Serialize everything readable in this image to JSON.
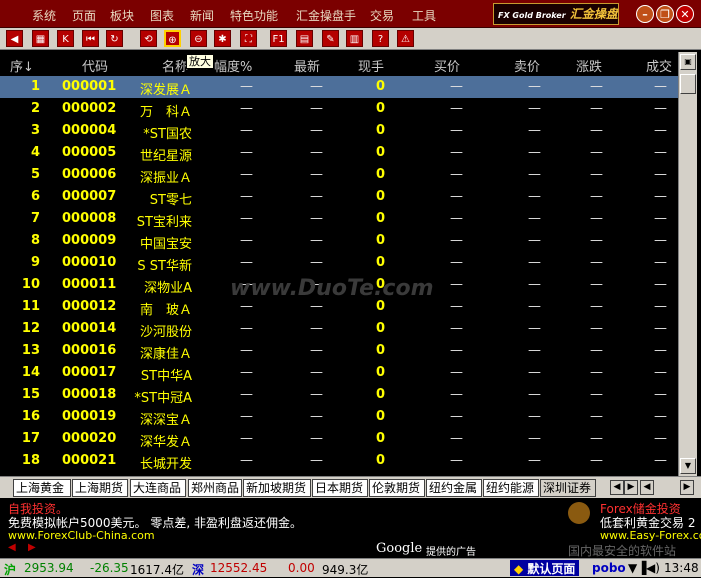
{
  "menu": [
    "系统",
    "页面",
    "板块",
    "图表",
    "新闻",
    "特色功能",
    "汇金操盘手",
    "交易",
    "工具"
  ],
  "logo": {
    "small": "FX Gold Broker",
    "main": "汇金操盘手"
  },
  "window_buttons": [
    "minimize",
    "restore",
    "close"
  ],
  "toolbar_icons": [
    "left-arrow-icon",
    "grid-icon",
    "k-chart-icon",
    "first-page-icon",
    "refresh-icon",
    "zoom-in-icon",
    "zoom-out-icon",
    "settings-icon",
    "fullscreen-icon",
    "f1-icon",
    "chart-icon",
    "edit-icon",
    "info-icon",
    "help-icon",
    "alert-icon"
  ],
  "tooltip": "放大",
  "columns": [
    "序↓",
    "代码",
    "名称",
    "幅度%",
    "最新",
    "现手",
    "买价",
    "卖价",
    "涨跌",
    "成交"
  ],
  "rows": [
    {
      "no": "1",
      "code": "000001",
      "name": "深发展Ａ",
      "hand": "0"
    },
    {
      "no": "2",
      "code": "000002",
      "name": "万　科Ａ",
      "hand": "0"
    },
    {
      "no": "3",
      "code": "000004",
      "name": "*ST国农",
      "hand": "0"
    },
    {
      "no": "4",
      "code": "000005",
      "name": "世纪星源",
      "hand": "0"
    },
    {
      "no": "5",
      "code": "000006",
      "name": "深振业Ａ",
      "hand": "0"
    },
    {
      "no": "6",
      "code": "000007",
      "name": "ST零七",
      "hand": "0"
    },
    {
      "no": "7",
      "code": "000008",
      "name": "ST宝利来",
      "hand": "0"
    },
    {
      "no": "8",
      "code": "000009",
      "name": "中国宝安",
      "hand": "0"
    },
    {
      "no": "9",
      "code": "000010",
      "name": "S ST华新",
      "hand": "0"
    },
    {
      "no": "10",
      "code": "000011",
      "name": "深物业A",
      "hand": "0"
    },
    {
      "no": "11",
      "code": "000012",
      "name": "南　玻Ａ",
      "hand": "0"
    },
    {
      "no": "12",
      "code": "000014",
      "name": "沙河股份",
      "hand": "0"
    },
    {
      "no": "13",
      "code": "000016",
      "name": "深康佳Ａ",
      "hand": "0"
    },
    {
      "no": "14",
      "code": "000017",
      "name": "ST中华A",
      "hand": "0"
    },
    {
      "no": "15",
      "code": "000018",
      "name": "*ST中冠A",
      "hand": "0"
    },
    {
      "no": "16",
      "code": "000019",
      "name": "深深宝Ａ",
      "hand": "0"
    },
    {
      "no": "17",
      "code": "000020",
      "name": "深华发Ａ",
      "hand": "0"
    },
    {
      "no": "18",
      "code": "000021",
      "name": "长城开发",
      "hand": "0"
    }
  ],
  "dash": "—",
  "tabs": [
    "上海黄金",
    "上海期货",
    "大连商品",
    "郑州商品",
    "新加坡期货",
    "日本期货",
    "伦敦期货",
    "纽约金属",
    "纽约能源",
    "深圳证券"
  ],
  "ad": {
    "left_title": "自我投资。",
    "left_body": "免费模拟帐户5000美元。 零点差, 非盈利盘返还佣金。",
    "left_url": "www.ForexClub-China.com",
    "right_title": "Forex储金投资",
    "right_body": "低套利黄金交易 2",
    "right_url": "www.Easy-Forex.com",
    "google": "Google",
    "google_suffix": "提供的广告",
    "watermark_bottom": "国内最安全的软件站",
    "watermark_center": "www.DuoTe.com"
  },
  "status": {
    "sh_label": "沪",
    "sh_index": "2953.94",
    "sh_change": "-26.35",
    "sh_volume": "1617.4亿",
    "sz_label": "深",
    "sz_index": "12552.45",
    "sz_change": "0.00",
    "sz_volume": "949.3亿",
    "default_page": "默认页面",
    "pobo": "pobo",
    "time": "13:48"
  },
  "colors": {
    "menubar": "#7b0000",
    "selected_row": "#4d6f9a",
    "yellow": "#ffff00",
    "up": "#ff3030",
    "down": "#00c000"
  }
}
